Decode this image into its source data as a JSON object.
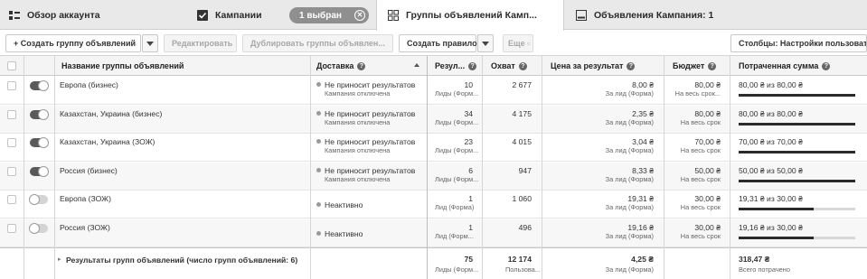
{
  "tabs": {
    "account": "Обзор аккаунта",
    "campaigns": "Кампании",
    "selected_pill": "1 выбран",
    "adsets": "Группы объявлений Камп...",
    "ads": "Объявления Кампания: 1"
  },
  "toolbar": {
    "create": "+ Создать группу объявлений",
    "edit": "Редактировать",
    "duplicate": "Дублировать группы объявлен...",
    "create_rule": "Создать правило",
    "more": "Еще ▫",
    "columns": "Столбцы: Настройки пользовател"
  },
  "columns": {
    "name": "Название группы объявлений",
    "delivery": "Доставка",
    "results": "Резул...",
    "reach": "Охват",
    "cost": "Цена за результат",
    "budget": "Бюджет",
    "spent": "Потраченная сумма"
  },
  "rows": [
    {
      "name": "Европа (бизнес)",
      "toggle_on": true,
      "delivery": "Не приносит результатов",
      "delivery_sub": "Кампания отключена",
      "results": "10",
      "results_sub": "Лиды (Форм...",
      "reach": "2 677",
      "cost": "8,00 ₴",
      "cost_sub": "За лид (Форма)",
      "budget": "80,00 ₴",
      "budget_sub": "На весь срок...",
      "spent": "80,00 ₴ из 80,00 ₴",
      "spent_fraction": 1.0
    },
    {
      "name": "Казахстан, Украина (бизнес)",
      "toggle_on": true,
      "delivery": "Не приносит результатов",
      "delivery_sub": "Кампания отключена",
      "results": "34",
      "results_sub": "Лиды (Форм...",
      "reach": "4 175",
      "cost": "2,35 ₴",
      "cost_sub": "За лид (Форма)",
      "budget": "80,00 ₴",
      "budget_sub": "На весь срок",
      "spent": "80,00 ₴ из 80,00 ₴",
      "spent_fraction": 1.0
    },
    {
      "name": "Казахстан, Украина (ЗОЖ)",
      "toggle_on": true,
      "delivery": "Не приносит результатов",
      "delivery_sub": "Кампания отключена",
      "results": "23",
      "results_sub": "Лиды (Форм...",
      "reach": "4 015",
      "cost": "3,04 ₴",
      "cost_sub": "За лид (Форма)",
      "budget": "70,00 ₴",
      "budget_sub": "На весь срок",
      "spent": "70,00 ₴ из 70,00 ₴",
      "spent_fraction": 1.0
    },
    {
      "name": "Россия (бизнес)",
      "toggle_on": true,
      "delivery": "Не приносит результатов",
      "delivery_sub": "Кампания отключена",
      "results": "6",
      "results_sub": "Лиды (Форм...",
      "reach": "947",
      "cost": "8,33 ₴",
      "cost_sub": "За лид (Форма)",
      "budget": "50,00 ₴",
      "budget_sub": "На весь срок",
      "spent": "50,00 ₴ из 50,00 ₴",
      "spent_fraction": 1.0
    },
    {
      "name": "Европа (ЗОЖ)",
      "toggle_on": false,
      "delivery": "Неактивно",
      "delivery_sub": "",
      "results": "1",
      "results_sub": "Лид (Форма)",
      "reach": "1 060",
      "cost": "19,31 ₴",
      "cost_sub": "За лид (Форма)",
      "budget": "30,00 ₴",
      "budget_sub": "На весь срок",
      "spent": "19,31 ₴ из 30,00 ₴",
      "spent_fraction": 0.64
    },
    {
      "name": "Россия (ЗОЖ)",
      "toggle_on": false,
      "delivery": "Неактивно",
      "delivery_sub": "",
      "results": "1",
      "results_sub": "Лид (Форм...",
      "reach": "496",
      "cost": "19,16 ₴",
      "cost_sub": "За лид (Форма)",
      "budget": "30,00 ₴",
      "budget_sub": "На весь срок",
      "spent": "19,16 ₴ из 30,00 ₴",
      "spent_fraction": 0.64
    }
  ],
  "footer": {
    "label": "Результаты групп объявлений (число групп объявлений: 6)",
    "results": "75",
    "results_sub": "Лиды (Форм...",
    "reach": "12 174",
    "reach_sub": "Пользова...",
    "cost": "4,25 ₴",
    "cost_sub": "За лид (Форма)",
    "spent": "318,47 ₴",
    "spent_sub": "Всего потрачено"
  }
}
